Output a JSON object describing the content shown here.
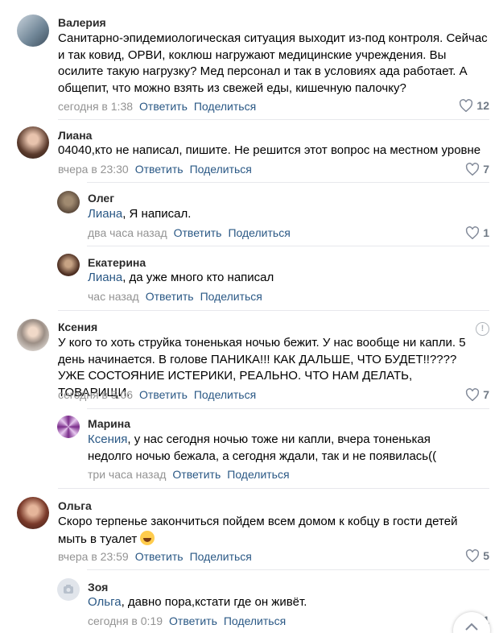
{
  "actions": {
    "reply": "Ответить",
    "share": "Поделиться"
  },
  "comments": [
    {
      "name": "Валерия",
      "text": "Санитарно-эпидемиологическая ситуация выходит из-под контроля. Сейчас и так ковид, ОРВИ, коклюш нагружают медицинские учреждения. Вы осилите такую нагрузку? Мед персонал и так в условиях ада работает. А общепит, что можно взять из свежей еды, кишечную палочку?",
      "time": "сегодня в 1:38",
      "likes": "12"
    },
    {
      "name": "Лиана",
      "text": "04040,кто не написал, пишите. Не решится этот вопрос на местном уровне",
      "time": "вчера в 23:30",
      "likes": "7",
      "replies": [
        {
          "name": "Олег",
          "mention": "Лиана",
          "text": ", Я написал.",
          "time": "два часа назад",
          "likes": "1"
        },
        {
          "name": "Екатерина",
          "mention": "Лиана",
          "text": ", да уже много кто написал",
          "time": "час назад",
          "likes": ""
        }
      ]
    },
    {
      "name": "Ксения",
      "text": "У кого то хоть струйка тоненькая ночью бежит. У нас вообще ни капли. 5 день начинается. В голове ПАНИКА!!! КАК ДАЛЬШЕ, ЧТО БУДЕТ!!???? УЖЕ СОСТОЯНИЕ ИСТЕРИКИ, РЕАЛЬНО. ЧТО НАМ ДЕЛАТЬ, ТОВАРИЩИ.",
      "time": "сегодня в 5:06",
      "likes": "7",
      "replies": [
        {
          "name": "Марина",
          "mention": "Ксения",
          "text": ", у нас сегодня ночью тоже ни капли, вчера тоненькая недолго ночью бежала, а сегодня ждали, так и не появилась((",
          "time": "три часа назад",
          "likes": ""
        }
      ]
    },
    {
      "name": "Ольга",
      "text": "Скоро терпенье закончиться пойдем всем домом к кобцу в гости детей мыть в туалет",
      "time": "вчера в 23:59",
      "likes": "5",
      "replies": [
        {
          "name": "Зоя",
          "mention": "Ольга",
          "text": ", давно пора,кстати где он живёт.",
          "time": "сегодня в 0:19",
          "likes": "1"
        }
      ]
    }
  ],
  "colors": {
    "link": "#2a5885",
    "meta": "#939393",
    "likes": "#6f7985"
  }
}
